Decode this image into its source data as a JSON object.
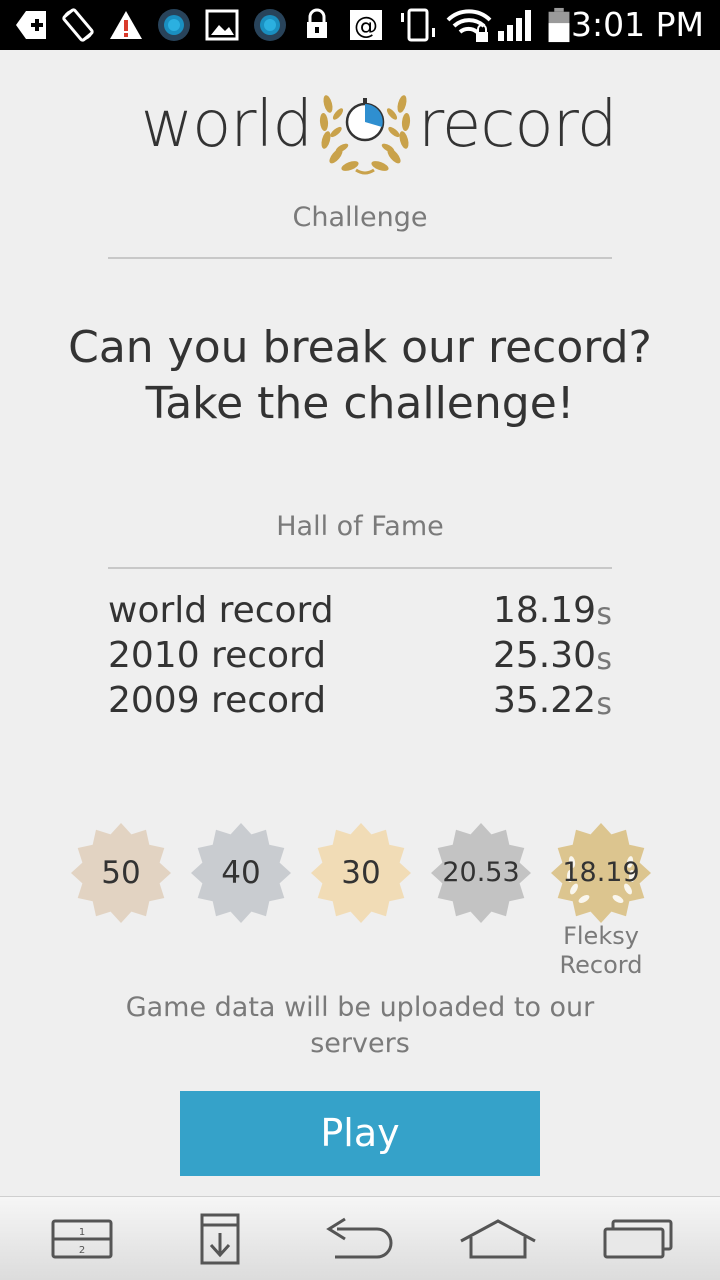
{
  "status_bar": {
    "time": "3:01 PM",
    "icons": [
      "add-icon",
      "screen-rotation-icon",
      "warning-icon",
      "app-circle-icon",
      "image-icon",
      "app-circle-icon",
      "lock-icon",
      "at-sign-icon",
      "vibrate-icon",
      "wifi-lock-icon",
      "signal-icon",
      "battery-icon"
    ]
  },
  "logo": {
    "left_word": "world",
    "right_word": "record",
    "emblem": "laurel-stopwatch-icon",
    "gold_color": "#c9a24b",
    "blue_color": "#2f8fd0"
  },
  "challenge": {
    "label": "Challenge"
  },
  "headline": {
    "line1": "Can you break our record?",
    "line2": "Take the challenge!"
  },
  "hall_of_fame": {
    "label": "Hall of Fame",
    "rows": [
      {
        "name": "world record",
        "time": "18.19",
        "unit": "s"
      },
      {
        "name": "2010 record",
        "time": "25.30",
        "unit": "s"
      },
      {
        "name": "2009 record",
        "time": "35.22",
        "unit": "s"
      }
    ]
  },
  "badges": [
    {
      "value": "50",
      "color": "#e2d3c2"
    },
    {
      "value": "40",
      "color": "#c9ccd0"
    },
    {
      "value": "30",
      "color": "#f1dcb6"
    },
    {
      "value": "20.53",
      "color": "#c3c3c3"
    },
    {
      "value": "18.19",
      "color": "#dcc58f"
    }
  ],
  "fleksy_label": {
    "line1": "Fleksy",
    "line2": "Record"
  },
  "upload_note": {
    "line1": "Game data will be uploaded to our",
    "line2": "servers"
  },
  "play_button": {
    "label": "Play",
    "color": "#35a2c9"
  },
  "nav_bar": {
    "buttons": [
      "dual-window-icon",
      "download-icon",
      "back-icon",
      "home-icon",
      "recent-apps-icon"
    ],
    "dual_window_numbers": [
      "1",
      "2"
    ]
  }
}
